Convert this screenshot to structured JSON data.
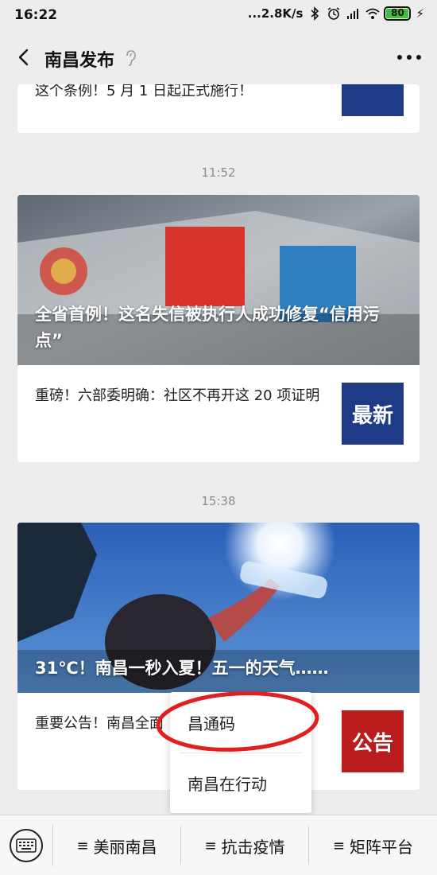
{
  "status_bar": {
    "time": "16:22",
    "net_speed": "...2.8K/s",
    "battery_level": "80"
  },
  "nav": {
    "title": "南昌发布"
  },
  "messages": [
    {
      "partial_line": "这个条例！5 月 1 日起正式施行！"
    },
    {
      "timestamp": "11:52",
      "hero_title": "全省首例！这名失信被执行人成功修复“信用污点”",
      "sub_title": "重磅！六部委明确：社区不再开这 20 项证明",
      "sub_thumb_text": "最新"
    },
    {
      "timestamp": "15:38",
      "hero_title": "31℃！南昌一秒入夏！五一的天气……",
      "sub_title": "重要公告！南昌全面",
      "sub_thumb_text": "公告"
    }
  ],
  "popup_menu": {
    "items": [
      "昌通码",
      "南昌在行动"
    ]
  },
  "bottom_menu": {
    "tabs": [
      "美丽南昌",
      "抗击疫情",
      "矩阵平台"
    ]
  },
  "colors": {
    "annotation_circle": "#e02020",
    "battery_fill": "#3cc13c",
    "thumb_blue": "#1f3a86",
    "thumb_red": "#b81c1c"
  }
}
